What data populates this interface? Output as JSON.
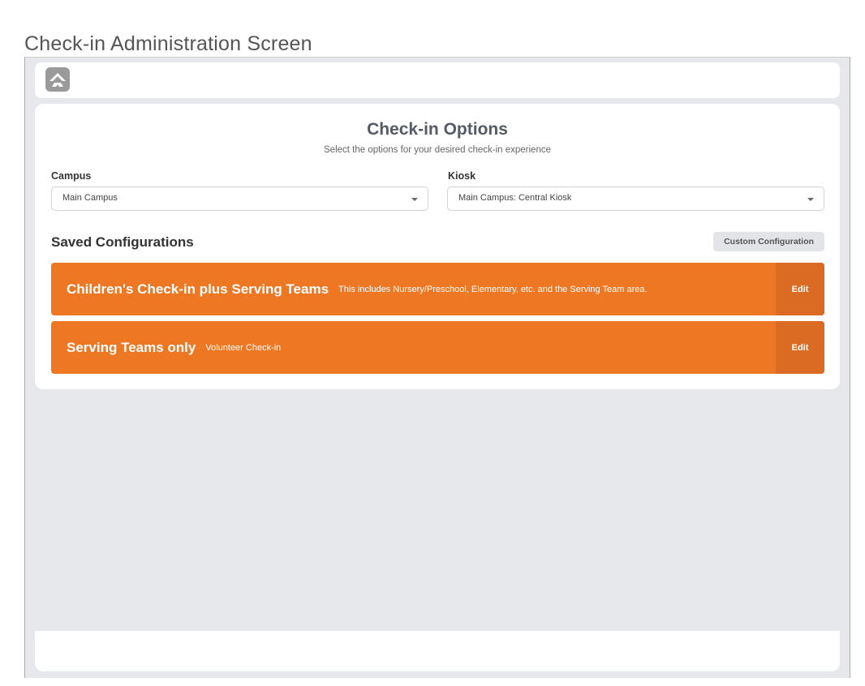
{
  "caption": "Check-in Administration Screen",
  "header": {
    "logo": "rock-logo-icon"
  },
  "options": {
    "title": "Check-in Options",
    "subtitle": "Select the options for your desired check-in experience",
    "campus": {
      "label": "Campus",
      "value": "Main Campus"
    },
    "kiosk": {
      "label": "Kiosk",
      "value": "Main Campus: Central Kiosk"
    }
  },
  "saved": {
    "title": "Saved Configurations",
    "custom_button": "Custom Configuration",
    "configs": [
      {
        "name": "Children's Check-in plus Serving Teams",
        "description": "This includes Nursery/Preschool, Elementary, etc. and the Serving Team area.",
        "edit_label": "Edit"
      },
      {
        "name": "Serving Teams only",
        "description": "Volunteer Check-in",
        "edit_label": "Edit"
      }
    ]
  },
  "colors": {
    "accent": "#ee7724",
    "accent_dark": "#db6a22",
    "background": "#e7e8ec"
  }
}
